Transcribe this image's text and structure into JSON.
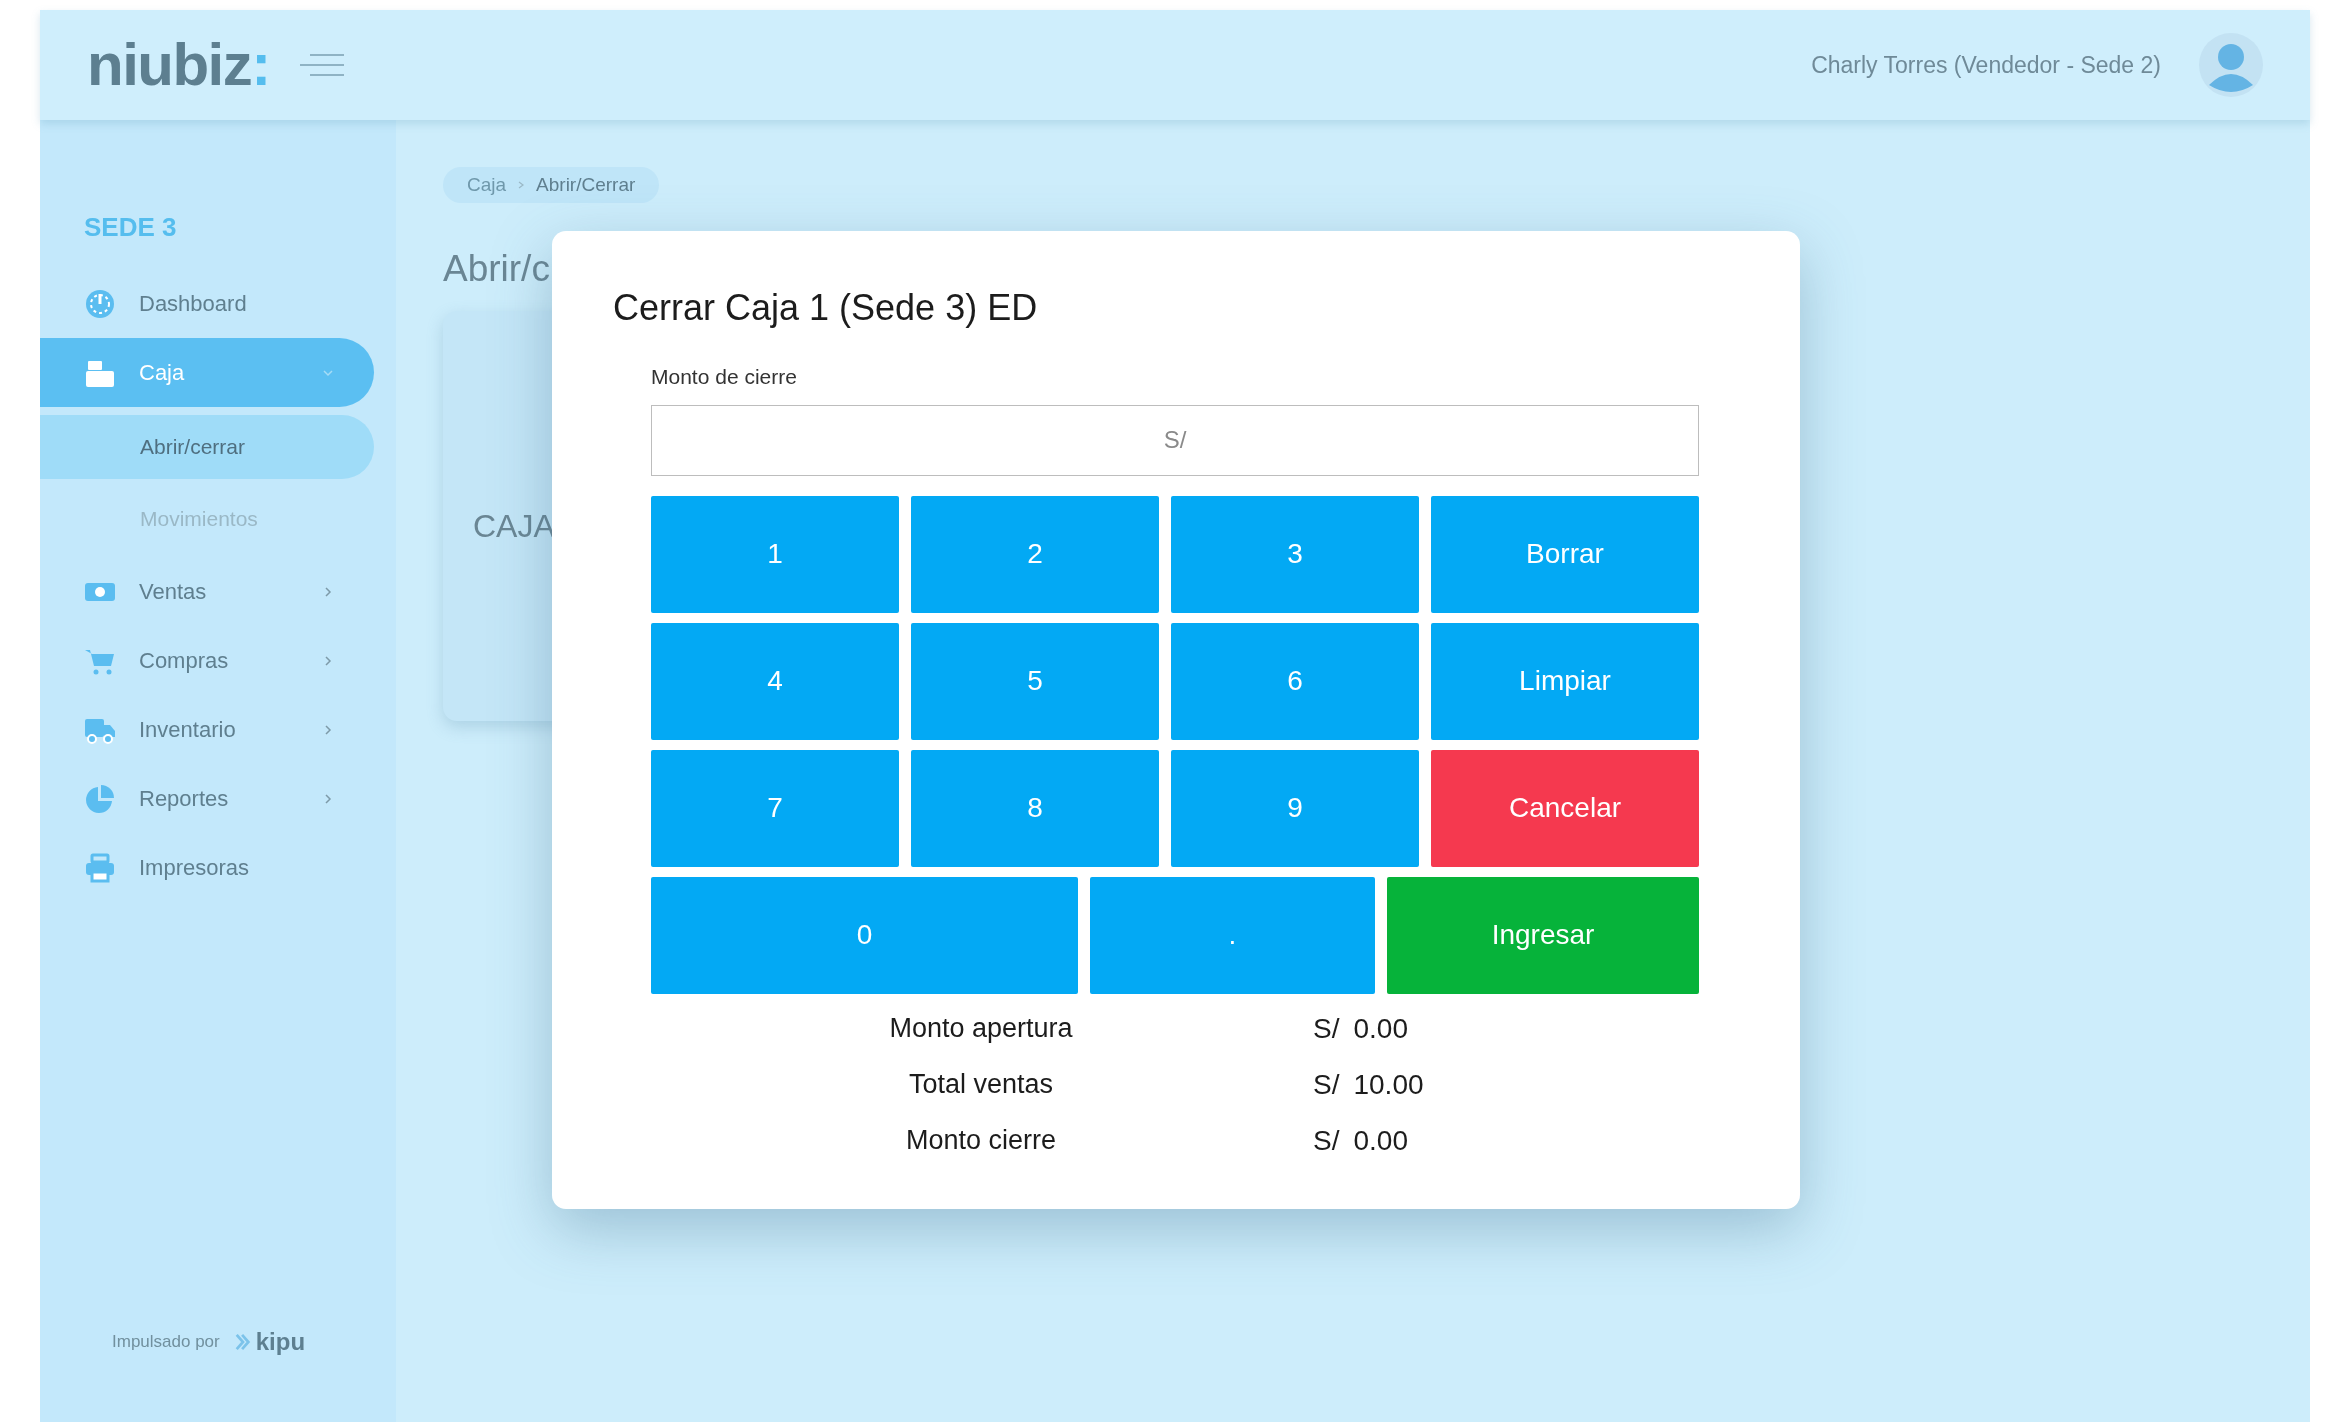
{
  "header": {
    "logo_text": "niubiz",
    "logo_accent": ":",
    "user": "Charly Torres (Vendedor - Sede 2)"
  },
  "sidebar": {
    "section": "SEDE 3",
    "items": [
      {
        "label": "Dashboard",
        "kind": "link",
        "selected": false
      },
      {
        "label": "Caja",
        "kind": "group",
        "selected": true,
        "expanded": true,
        "children": [
          {
            "label": "Abrir/cerrar",
            "selected": true
          },
          {
            "label": "Movimientos",
            "selected": false
          }
        ]
      },
      {
        "label": "Ventas",
        "kind": "group",
        "selected": false,
        "expanded": false
      },
      {
        "label": "Compras",
        "kind": "group",
        "selected": false,
        "expanded": false
      },
      {
        "label": "Inventario",
        "kind": "group",
        "selected": false,
        "expanded": false
      },
      {
        "label": "Reportes",
        "kind": "group",
        "selected": false,
        "expanded": false
      },
      {
        "label": "Impresoras",
        "kind": "link",
        "selected": false
      }
    ],
    "footer": {
      "text": "Impulsado por",
      "brand": "kipu"
    }
  },
  "breadcrumb": [
    "Caja",
    "Abrir/Cerrar"
  ],
  "page_title": "Abrir/c",
  "card": {
    "label": "CAJA"
  },
  "modal": {
    "title": "Cerrar Caja 1 (Sede 3) ED",
    "field": {
      "label": "Monto de cierre",
      "placeholder": "S/"
    },
    "keys": [
      [
        {
          "label": "1",
          "kind": "digit"
        },
        {
          "label": "2",
          "kind": "digit"
        },
        {
          "label": "3",
          "kind": "digit"
        },
        {
          "label": "Borrar",
          "kind": "action"
        }
      ],
      [
        {
          "label": "4",
          "kind": "digit"
        },
        {
          "label": "5",
          "kind": "digit"
        },
        {
          "label": "6",
          "kind": "digit"
        },
        {
          "label": "Limpiar",
          "kind": "action"
        }
      ],
      [
        {
          "label": "7",
          "kind": "digit"
        },
        {
          "label": "8",
          "kind": "digit"
        },
        {
          "label": "9",
          "kind": "digit"
        },
        {
          "label": "Cancelar",
          "kind": "cancel"
        }
      ],
      [
        {
          "label": "0",
          "kind": "digit"
        },
        {
          "label": ".",
          "kind": "digit"
        },
        {
          "label": "Ingresar",
          "kind": "submit"
        }
      ]
    ],
    "summary": [
      {
        "label": "Monto apertura",
        "currency": "S/",
        "amount": "0.00"
      },
      {
        "label": "Total ventas",
        "currency": "S/",
        "amount": "10.00"
      },
      {
        "label": "Monto cierre",
        "currency": "S/",
        "amount": "0.00"
      }
    ]
  }
}
